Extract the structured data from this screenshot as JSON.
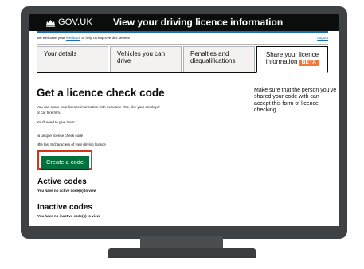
{
  "header": {
    "brand": "GOV.UK",
    "service_name": "View your driving licence information"
  },
  "phase": {
    "text_before": "We welcome your ",
    "feedback_link": "feedback",
    "text_after": " to help us improve this service",
    "logout_link": "Logout"
  },
  "tabs": [
    {
      "label": "Your details"
    },
    {
      "label": "Vehicles you can drive"
    },
    {
      "label_line1": "Penalties and",
      "label_line2": "disqualifications"
    },
    {
      "label_line1": "Share your licence",
      "label_line2": "information",
      "badge": "BETA"
    }
  ],
  "main": {
    "title": "Get a licence check code",
    "intro": "You can share your licence information with someone else, like your employer or car hire firm.",
    "need": "You'll need to give them:",
    "bullets": [
      "a unique licence check code",
      "the last 8 characters of your driving licence"
    ],
    "side_note": "Make sure that the person you've shared your code with can accept this form of licence checking.",
    "create_button": "Create a code",
    "active_heading": "Active codes",
    "active_text": "You have no active code(s) to view",
    "inactive_heading": "Inactive codes",
    "inactive_text": "You have no inactive code(s) to view"
  },
  "colors": {
    "header_bg": "#0b0c0c",
    "brand_blue": "#1d70b8",
    "button_green": "#00703c",
    "highlight_red": "#d4351c",
    "beta_orange": "#f47738",
    "monitor": "#3f4245"
  },
  "icons": {
    "crown": "crown-icon"
  }
}
